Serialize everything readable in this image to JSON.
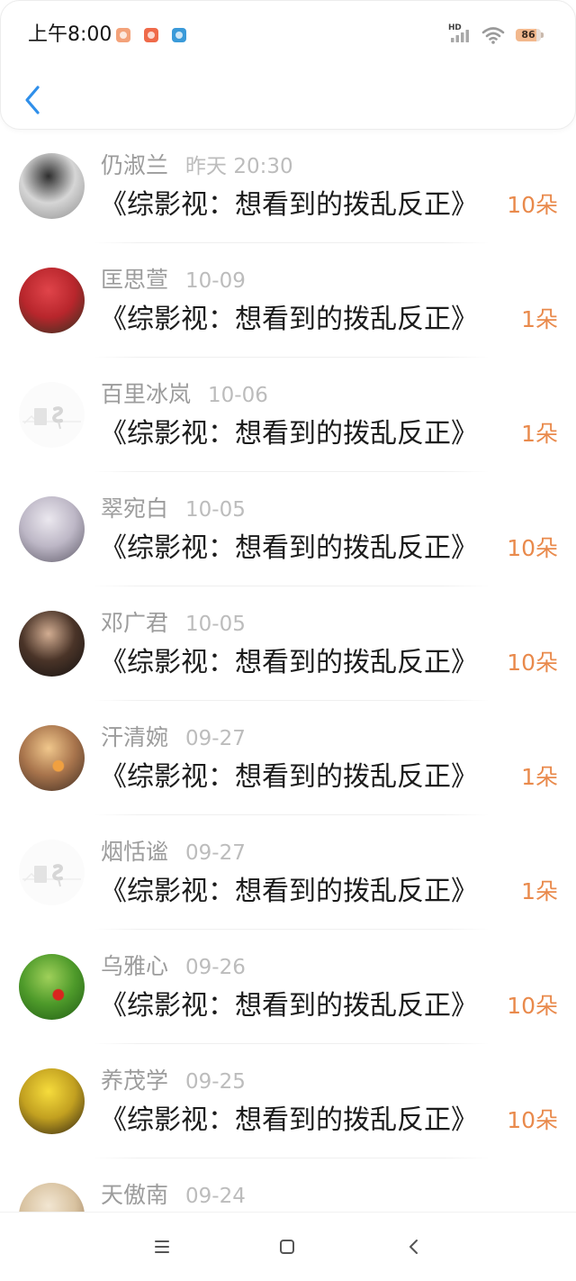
{
  "status_bar": {
    "time": "上午8:00",
    "notification_icons": [
      {
        "icon": "app-notification-icon",
        "color": "#f3a27a"
      },
      {
        "icon": "app-notification-icon",
        "color": "#ef6a4a"
      },
      {
        "icon": "app-notification-icon",
        "color": "#3a9ad9"
      }
    ],
    "network_label": "HD",
    "signal_icon": "cellular-signal-icon",
    "wifi_icon": "wifi-icon",
    "battery_icon": "battery-icon",
    "battery_level": "86"
  },
  "header": {
    "back_icon": "chevron-left-icon"
  },
  "list": {
    "items": [
      {
        "name": "仍淑兰",
        "date": "昨天 20:30",
        "title": "《综影视：想看到的拨乱反正》",
        "count": "10朵",
        "avatar": {
          "colors": [
            "#2e2e2e",
            "#d6d6d6",
            "#8c8c8c"
          ]
        }
      },
      {
        "name": "匡思萱",
        "date": "10-09",
        "title": "《综影视：想看到的拨乱反正》",
        "count": "1朵",
        "avatar": {
          "colors": [
            "#e0444a",
            "#b8262c",
            "#2a3320"
          ]
        }
      },
      {
        "name": "百里冰岚",
        "date": "10-06",
        "title": "《综影视：想看到的拨乱反正》",
        "count": "1朵",
        "avatar": {
          "placeholder": true
        }
      },
      {
        "name": "翠宛白",
        "date": "10-05",
        "title": "《综影视：想看到的拨乱反正》",
        "count": "10朵",
        "avatar": {
          "colors": [
            "#ebe8ef",
            "#bdb7c6",
            "#5c5866"
          ]
        }
      },
      {
        "name": "邓广君",
        "date": "10-05",
        "title": "《综影视：想看到的拨乱反正》",
        "count": "10朵",
        "avatar": {
          "colors": [
            "#d2ad92",
            "#4a3428",
            "#121010"
          ]
        }
      },
      {
        "name": "汗清婉",
        "date": "09-27",
        "title": "《综影视：想看到的拨乱反正》",
        "count": "1朵",
        "avatar": {
          "colors": [
            "#f0c78c",
            "#a8744c",
            "#3d2c22"
          ],
          "accent": "#f0a040"
        }
      },
      {
        "name": "烟恬谧",
        "date": "09-27",
        "title": "《综影视：想看到的拨乱反正》",
        "count": "1朵",
        "avatar": {
          "placeholder": true
        }
      },
      {
        "name": "乌雅心",
        "date": "09-26",
        "title": "《综影视：想看到的拨乱反正》",
        "count": "10朵",
        "avatar": {
          "colors": [
            "#9fd05a",
            "#4e9a2a",
            "#1f5a14"
          ],
          "accent": "#d8261e"
        }
      },
      {
        "name": "养茂学",
        "date": "09-25",
        "title": "《综影视：想看到的拨乱反正》",
        "count": "10朵",
        "avatar": {
          "colors": [
            "#f6dc3c",
            "#c2a020",
            "#2a2012"
          ]
        }
      },
      {
        "name": "天傲南",
        "date": "09-24",
        "avatar": {
          "colors": [
            "#f2e6d2",
            "#d8c2a0",
            "#8a6a48"
          ]
        }
      }
    ]
  },
  "nav_bar": {
    "menu_icon": "menu-icon",
    "home_icon": "home-icon",
    "back_icon": "back-icon"
  },
  "colors": {
    "accent": "#2f8fea",
    "count": "#e98a4c",
    "name": "#9c9c9c",
    "date": "#bcbcbc",
    "title": "#1c1c1c"
  }
}
